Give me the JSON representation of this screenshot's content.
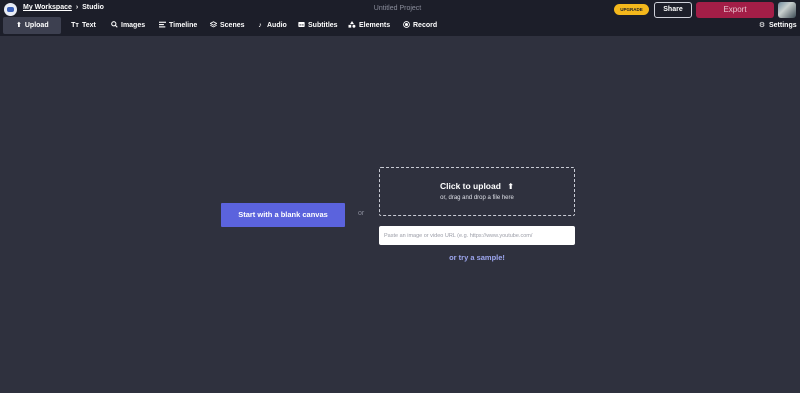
{
  "header": {
    "breadcrumb": {
      "workspace": "My Workspace",
      "separator": "›",
      "current": "Studio"
    },
    "project_title": "Untitled Project",
    "upgrade_label": "UPGRADE",
    "share_label": "Share",
    "export_label": "Export"
  },
  "toolbar": {
    "tabs": [
      {
        "label": "Upload",
        "icon": "upload-icon",
        "active": true
      },
      {
        "label": "Text",
        "icon": "text-icon"
      },
      {
        "label": "Images",
        "icon": "search-icon"
      },
      {
        "label": "Timeline",
        "icon": "timeline-icon"
      },
      {
        "label": "Scenes",
        "icon": "layers-icon"
      },
      {
        "label": "Audio",
        "icon": "music-note-icon"
      },
      {
        "label": "Subtitles",
        "icon": "subtitles-icon"
      },
      {
        "label": "Elements",
        "icon": "shapes-icon"
      },
      {
        "label": "Record",
        "icon": "record-icon"
      }
    ],
    "settings_label": "Settings"
  },
  "canvas": {
    "blank_canvas_label": "Start with a blank canvas",
    "or_label": "or",
    "dropzone": {
      "title": "Click to upload",
      "subtitle": "or, drag and drop a file here"
    },
    "url_placeholder": "Paste an image or video URL (e.g. https://www.youtube.com/",
    "sample_label": "or try a sample!"
  },
  "colors": {
    "background": "#2f313e",
    "topbar": "#1c1e29",
    "primary_button": "#5b63dd",
    "export_button": "#a31e47",
    "upgrade_badge": "#f4b81c",
    "link": "#9ea7f0"
  }
}
